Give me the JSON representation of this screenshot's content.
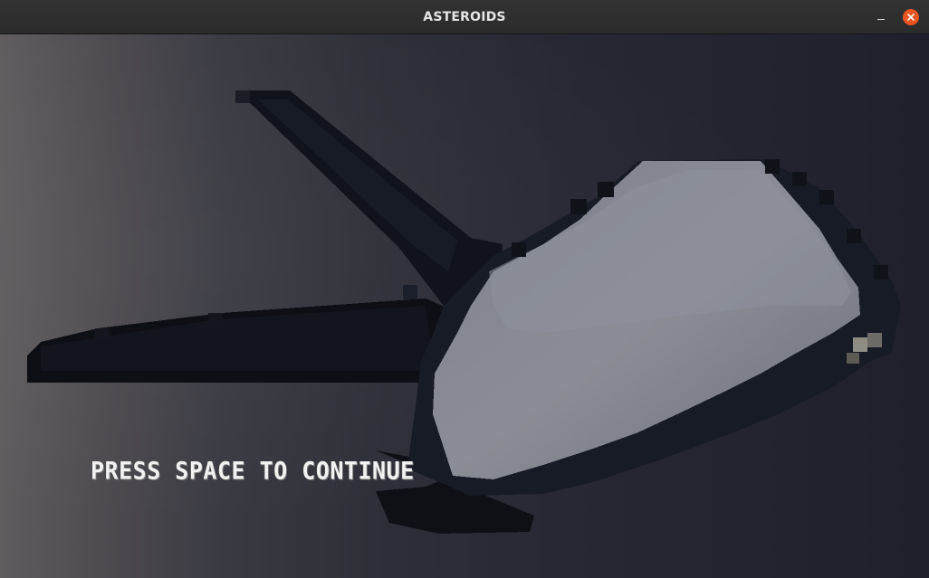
{
  "window": {
    "title": "ASTEROIDS"
  },
  "controls": {
    "minimize_icon": "minimize-icon",
    "close_icon": "close-icon",
    "close_color": "#e95420"
  },
  "game": {
    "prompt": "PRESS SPACE TO CONTINUE",
    "sprite": "spaceship-icon"
  }
}
